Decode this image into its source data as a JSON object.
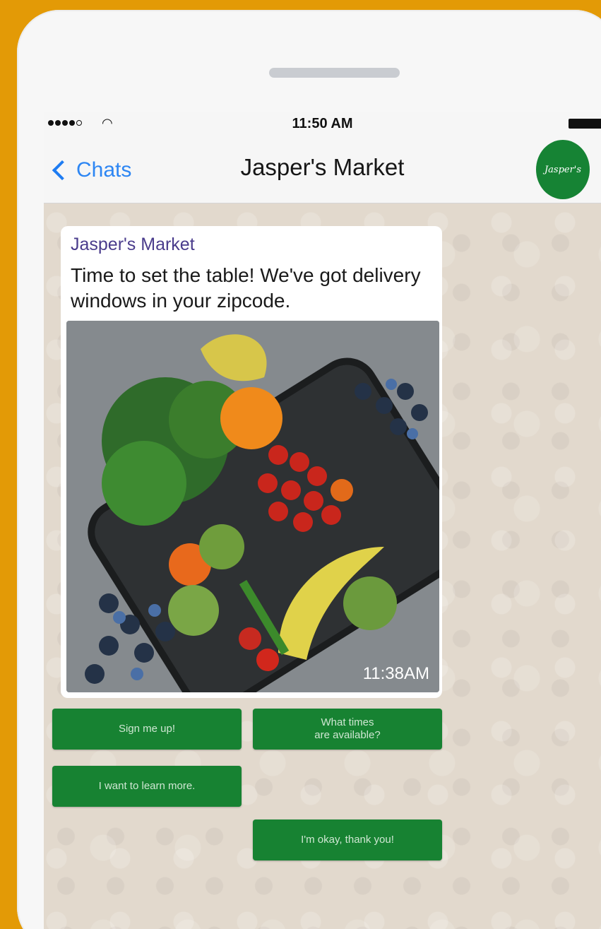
{
  "status_bar": {
    "time": "11:50 AM",
    "signal_icon": "signal-dots-icon",
    "wifi_icon": "wifi-icon",
    "battery_icon": "battery-icon"
  },
  "nav": {
    "back_label": "Chats",
    "title": "Jasper's Market",
    "avatar_text": "Jasper's",
    "avatar_color": "#168334"
  },
  "message": {
    "sender": "Jasper's Market",
    "text": "Time to set the table! We've got delivery windows in your zipcode.",
    "timestamp": "11:38AM",
    "image": "vegetables-and-fruit-basket"
  },
  "quick_replies": [
    {
      "label": "Sign me up!"
    },
    {
      "label": "What times\nare available?"
    },
    {
      "label": "I want to learn more."
    },
    {
      "label": "I'm okay, thank you!"
    }
  ],
  "colors": {
    "background": "#e39a06",
    "button": "#178232",
    "link": "#1e7cf2",
    "sender": "#4a3c8c"
  }
}
